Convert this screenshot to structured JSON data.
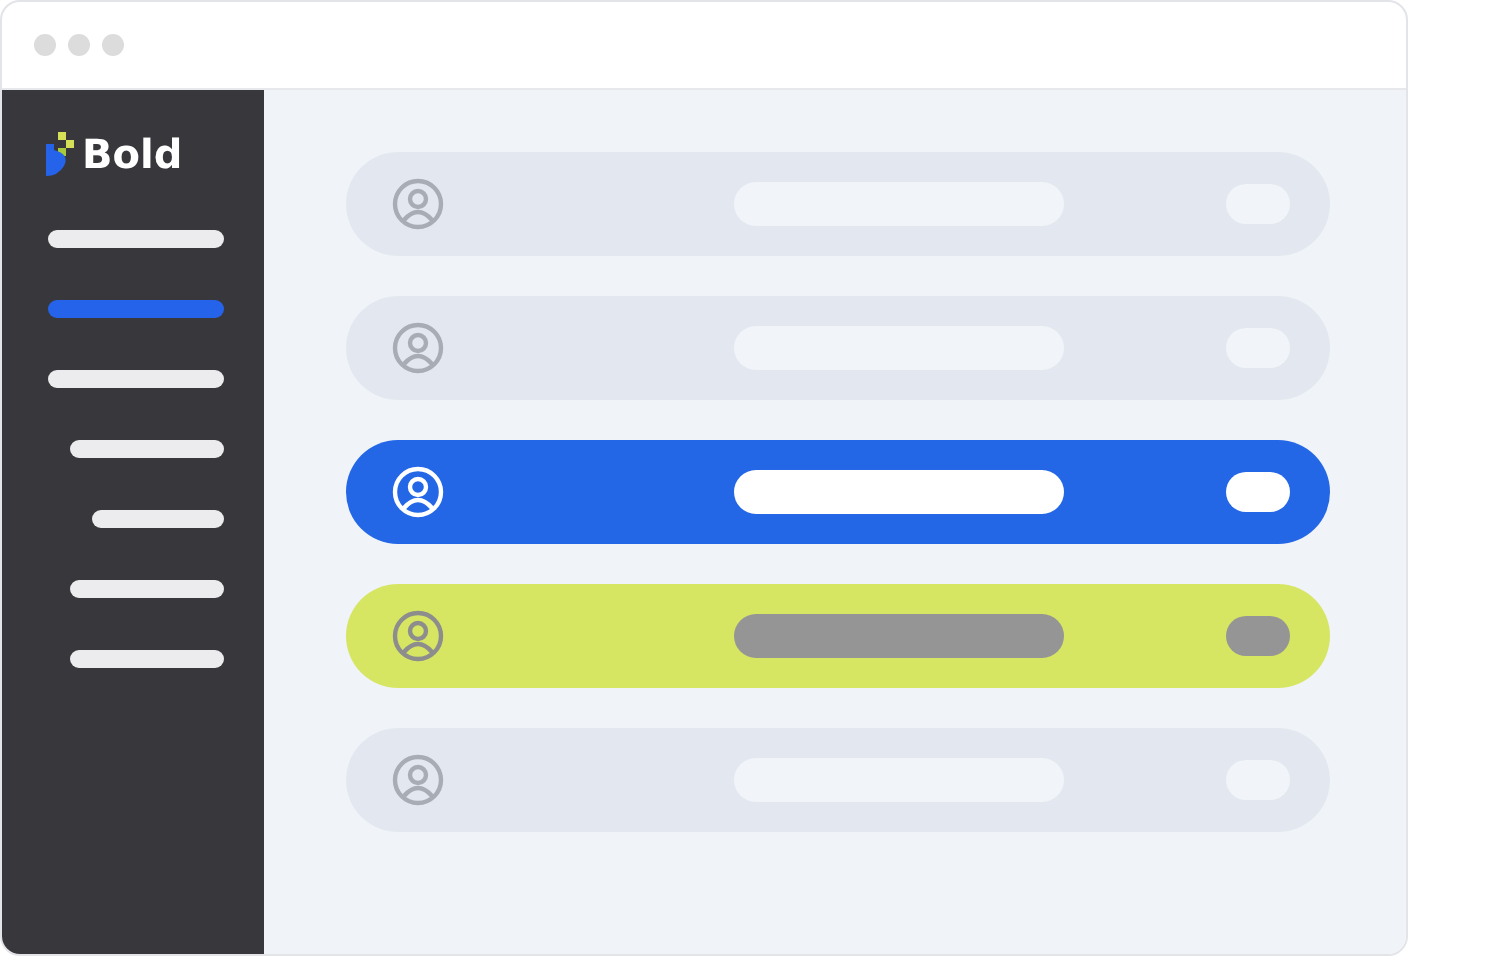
{
  "sidebar": {
    "logo_text": "Bold",
    "items": [
      {
        "selected": false
      },
      {
        "selected": true
      },
      {
        "selected": false,
        "children": [
          {
            "selected": false,
            "children": [
              {
                "selected": false
              }
            ]
          },
          {
            "selected": false
          },
          {
            "selected": false
          }
        ]
      }
    ]
  },
  "rows": [
    {
      "kind": "plain"
    },
    {
      "kind": "plain"
    },
    {
      "kind": "active"
    },
    {
      "kind": "flagged"
    },
    {
      "kind": "plain"
    }
  ]
}
